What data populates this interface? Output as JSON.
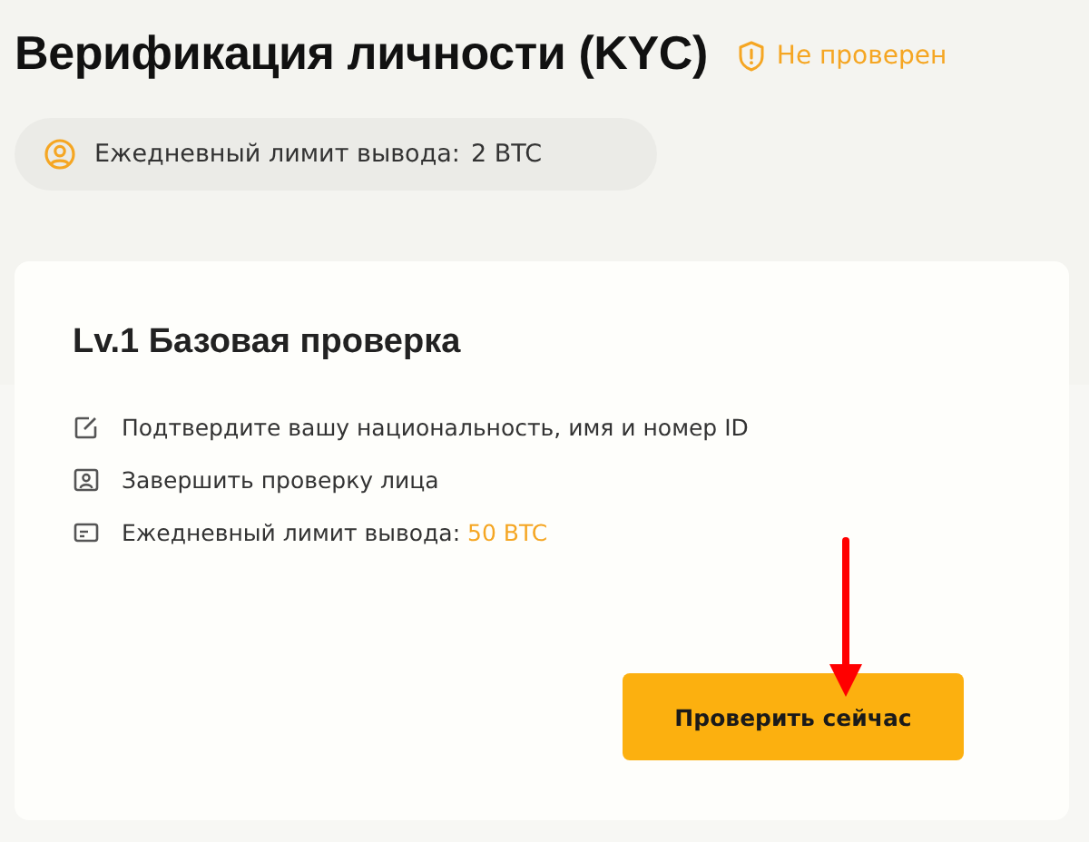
{
  "header": {
    "title": "Верификация личности (KYC)",
    "status": {
      "kind": "unverified",
      "label": "Не проверен"
    }
  },
  "current_limit": {
    "label": "Ежедневный лимит вывода:",
    "value": "2 BTC"
  },
  "level_card": {
    "title": "Lv.1 Базовая проверка",
    "items": [
      {
        "kind": "edit",
        "text": "Подтвердите вашу национальность, имя и номер ID"
      },
      {
        "kind": "face",
        "text": "Завершить проверку лица"
      },
      {
        "kind": "card",
        "text": "Ежедневный лимит вывода:",
        "value": "50 BTC"
      }
    ],
    "button": "Проверить сейчас"
  }
}
